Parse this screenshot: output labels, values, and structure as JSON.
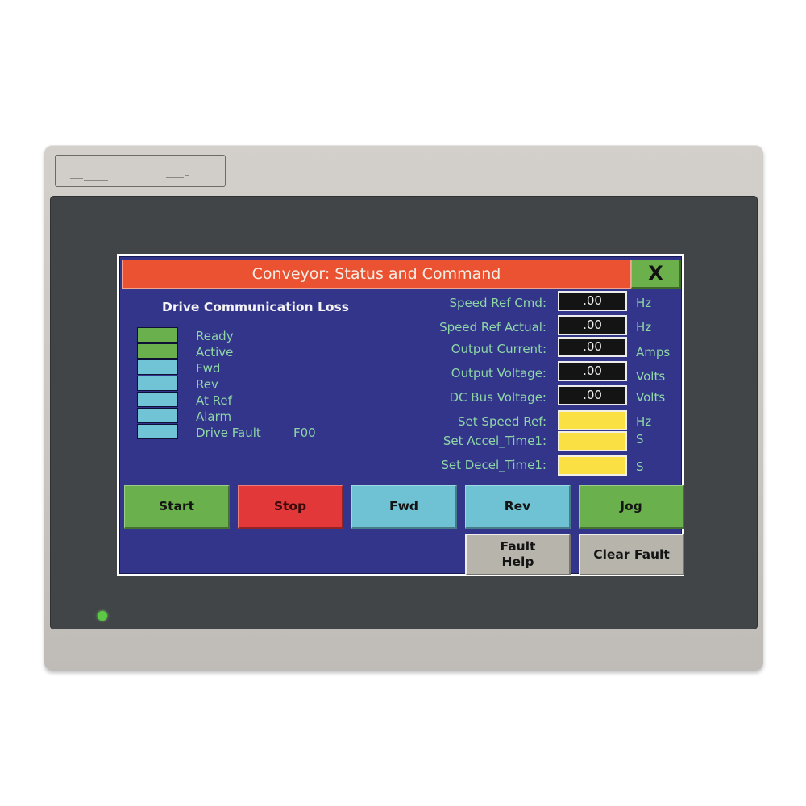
{
  "app": {
    "title": "Conveyor: Status and Command",
    "close_label": "X"
  },
  "status": {
    "heading": "Drive Communication Loss",
    "indicators": [
      {
        "label": "Ready",
        "state": "on",
        "color": "#6ab04c"
      },
      {
        "label": "Active",
        "state": "on",
        "color": "#6ab04c"
      },
      {
        "label": "Fwd",
        "state": "off",
        "color": "#71c4d6"
      },
      {
        "label": "Rev",
        "state": "off",
        "color": "#71c4d6"
      },
      {
        "label": "At Ref",
        "state": "off",
        "color": "#71c4d6"
      },
      {
        "label": "Alarm",
        "state": "off",
        "color": "#71c4d6"
      },
      {
        "label": "Drive Fault",
        "state": "off",
        "color": "#71c4d6"
      }
    ],
    "fault_code": "F00"
  },
  "readouts": [
    {
      "label": "Speed Ref Cmd:",
      "value": ".00",
      "unit": "Hz"
    },
    {
      "label": "Speed Ref Actual:",
      "value": ".00",
      "unit": "Hz"
    },
    {
      "label": "Output Current:",
      "value": ".00",
      "unit": "Amps"
    },
    {
      "label": "Output Voltage:",
      "value": ".00",
      "unit": "Volts"
    },
    {
      "label": "DC Bus Voltage:",
      "value": ".00",
      "unit": "Volts"
    }
  ],
  "setpoints": [
    {
      "label": "Set Speed Ref:",
      "value": "",
      "unit": "Hz"
    },
    {
      "label": "Set Accel_Time1:",
      "value": "",
      "unit": "S"
    },
    {
      "label": "Set Decel_Time1:",
      "value": "",
      "unit": "S"
    }
  ],
  "buttons": {
    "start": "Start",
    "stop": "Stop",
    "fwd": "Fwd",
    "rev": "Rev",
    "jog": "Jog",
    "fault_help_line1": "Fault",
    "fault_help_line2": "Help",
    "clear_fault": "Clear Fault"
  },
  "colors": {
    "background": "#33358a",
    "title_bar": "#ea5232",
    "label_text": "#8ed6a6",
    "input_fill": "#fbe043",
    "power_led": "#5cc844"
  }
}
